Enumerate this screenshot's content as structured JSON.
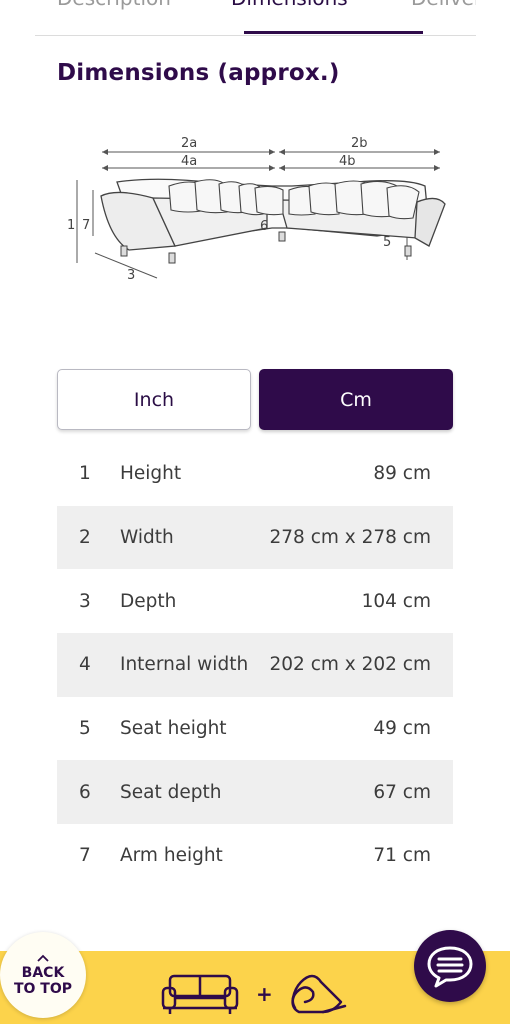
{
  "tabs": [
    {
      "label": "Description"
    },
    {
      "label": "Dimensions"
    },
    {
      "label": "Delivery"
    }
  ],
  "section_title": "Dimensions (approx.)",
  "diagram_labels": {
    "a2": "2a",
    "a4": "4a",
    "b2": "2b",
    "b4": "4b",
    "n1": "1",
    "n7": "7",
    "n3": "3",
    "n6": "6",
    "n5": "5"
  },
  "units": {
    "inch_label": "Inch",
    "cm_label": "Cm",
    "selected": "Cm"
  },
  "dimensions": [
    {
      "num": "1",
      "label": "Height",
      "value": "89 cm"
    },
    {
      "num": "2",
      "label": "Width",
      "value": "278 cm x 278 cm"
    },
    {
      "num": "3",
      "label": "Depth",
      "value": "104 cm"
    },
    {
      "num": "4",
      "label": "Internal width",
      "value": "202 cm x 202 cm"
    },
    {
      "num": "5",
      "label": "Seat height",
      "value": "49 cm"
    },
    {
      "num": "6",
      "label": "Seat depth",
      "value": "67 cm"
    },
    {
      "num": "7",
      "label": "Arm height",
      "value": "71 cm"
    }
  ],
  "back_to_top": {
    "line1": "BACK",
    "line2": "TO TOP"
  },
  "bottom_bar": {
    "plus": "+"
  },
  "icons": {
    "sofa": "sofa-icon",
    "rug": "rug-icon",
    "chat": "chat-icon",
    "back_chevron": "chevron-up-icon"
  },
  "colors": {
    "brand_purple": "#2f0b4a",
    "bar_yellow": "#fcd34b",
    "row_shade": "#efefef"
  }
}
